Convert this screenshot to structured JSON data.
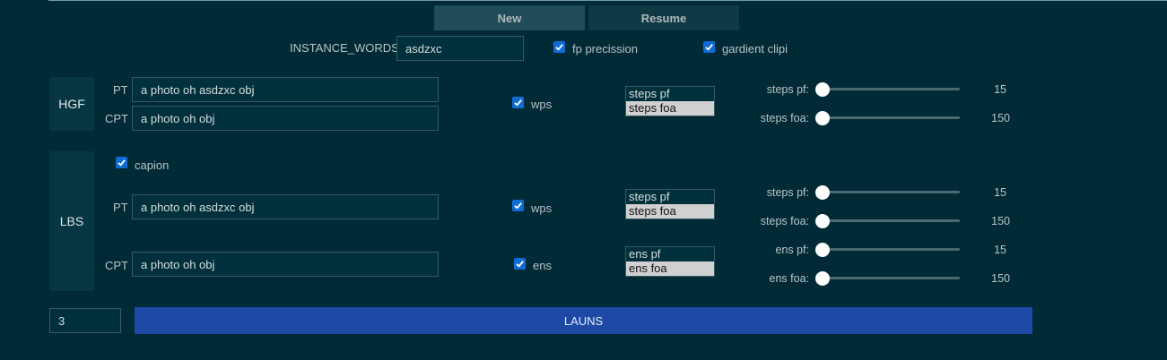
{
  "tabs": {
    "new": "New",
    "resume": "Resume"
  },
  "top": {
    "instance_words_label": "INSTANCE_WORDS",
    "instance_words_value": "asdzxc",
    "fp_label": "fp precission",
    "fp_checked": true,
    "grad_label": "gardient clipi",
    "grad_checked": true
  },
  "hgf": {
    "title": "HGF",
    "pt_label": "PT",
    "pt_value": "a photo oh asdzxc obj",
    "cpt_label": "CPT",
    "cpt_value": "a photo oh obj",
    "wps_label": "wps",
    "wps_checked": true,
    "list": [
      "steps pf",
      "steps foa"
    ],
    "sliders": [
      {
        "label": "steps pf:",
        "value": "15"
      },
      {
        "label": "steps foa:",
        "value": "150"
      }
    ]
  },
  "lbs": {
    "title": "LBS",
    "caption_label": "capion",
    "caption_checked": true,
    "pt_label": "PT",
    "pt_value": "a photo oh asdzxc obj",
    "cpt_label": "CPT",
    "cpt_value": "a photo oh obj",
    "wps_label": "wps",
    "wps_checked": true,
    "ens_label": "ens",
    "ens_checked": true,
    "list1": [
      "steps pf",
      "steps foa"
    ],
    "list2": [
      "ens pf",
      "ens foa"
    ],
    "sliders": [
      {
        "label": "steps pf:",
        "value": "15"
      },
      {
        "label": "steps foa:",
        "value": "150"
      },
      {
        "label": "ens pf:",
        "value": "15"
      },
      {
        "label": "ens foa:",
        "value": "150"
      }
    ]
  },
  "bottom": {
    "count_value": "3",
    "launch_label": "LAUNS"
  },
  "colors": {
    "background": "#002b36",
    "accent_blue": "#1e4aa6",
    "checkbox": "#0f6cd4"
  }
}
